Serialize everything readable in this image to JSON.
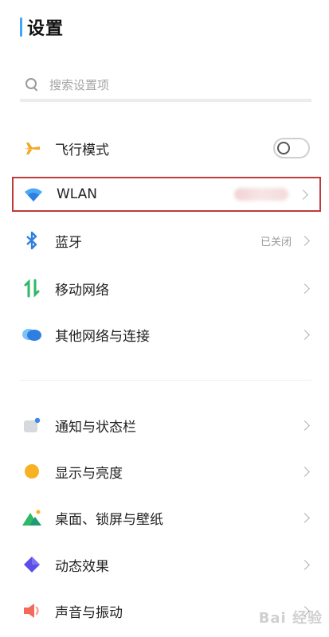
{
  "header": {
    "title": "设置"
  },
  "search": {
    "placeholder": "搜索设置项"
  },
  "network_items": [
    {
      "label": "飞行模式",
      "icon": "airplane-icon",
      "toggle_on": false
    },
    {
      "label": "WLAN",
      "icon": "wifi-icon"
    },
    {
      "label": "蓝牙",
      "icon": "bluetooth-icon",
      "value": "已关闭"
    },
    {
      "label": "移动网络",
      "icon": "mobile-data-icon"
    },
    {
      "label": "其他网络与连接",
      "icon": "cloud-icon"
    }
  ],
  "system_items": [
    {
      "label": "通知与状态栏",
      "icon": "notification-icon"
    },
    {
      "label": "显示与亮度",
      "icon": "brightness-icon"
    },
    {
      "label": "桌面、锁屏与壁纸",
      "icon": "wallpaper-icon"
    },
    {
      "label": "动态效果",
      "icon": "animation-icon"
    },
    {
      "label": "声音与振动",
      "icon": "sound-icon"
    }
  ],
  "watermark": {
    "text": "Bai 经验"
  },
  "colors": {
    "accent": "#3fa6ff",
    "highlight_border": "#c0393b"
  }
}
